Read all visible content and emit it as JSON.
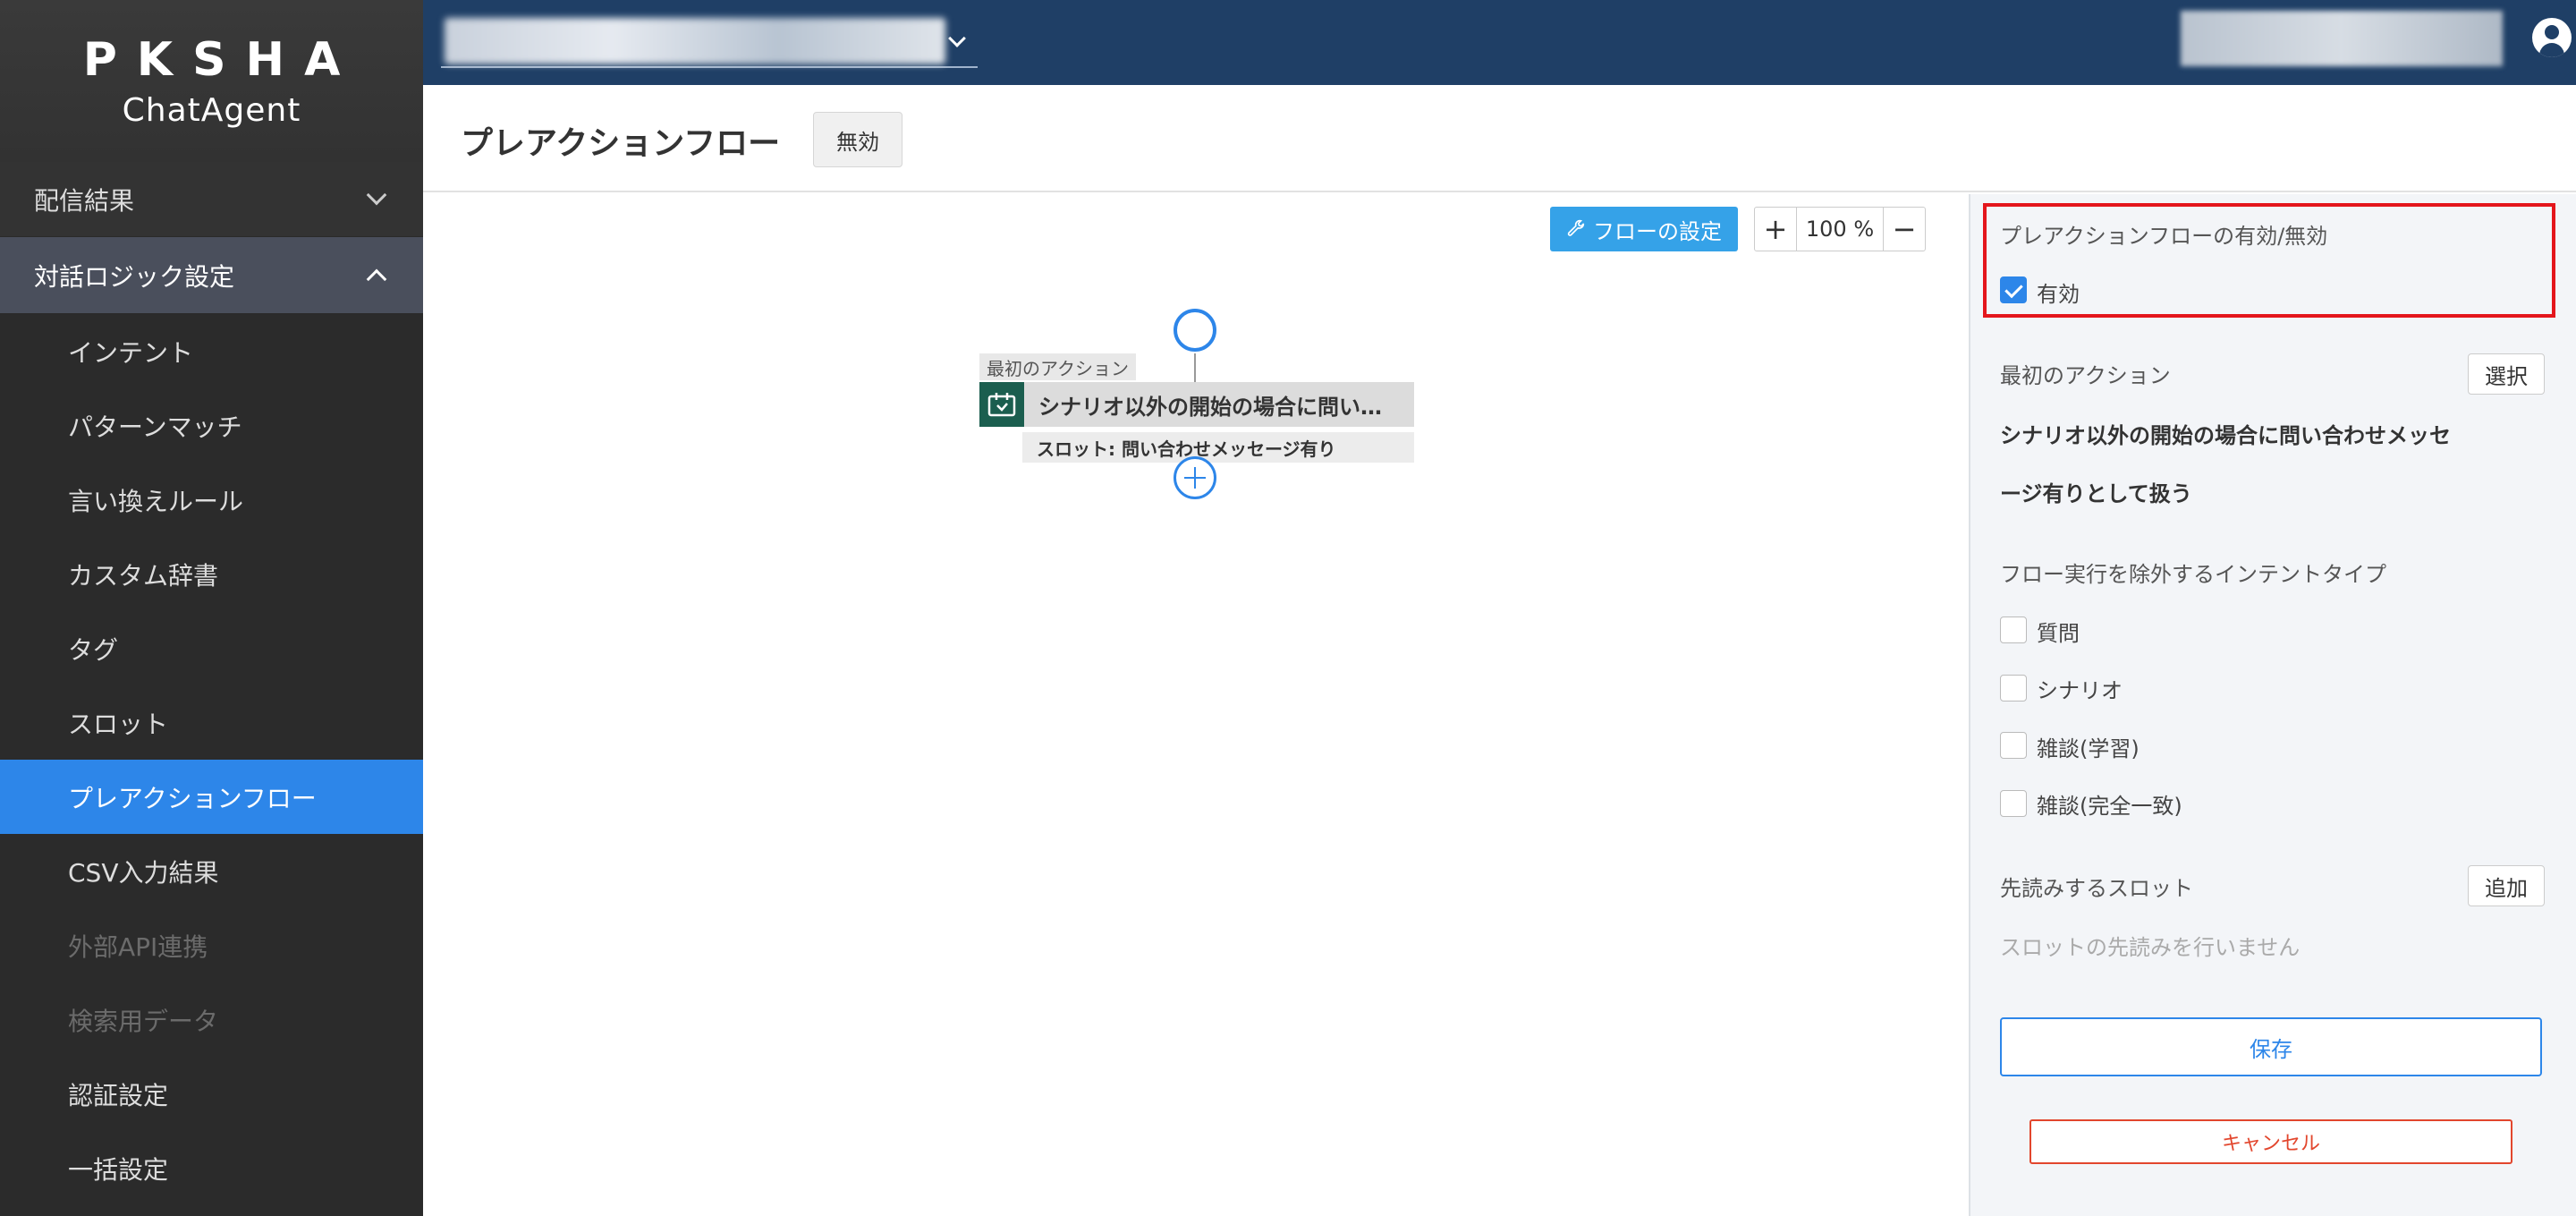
{
  "brand": {
    "name": "PKSHA",
    "product": "ChatAgent"
  },
  "sidebar": {
    "groups": [
      {
        "label": "配信結果"
      },
      {
        "label": "対話ロジック設定"
      }
    ],
    "items": [
      {
        "label": "インテント"
      },
      {
        "label": "パターンマッチ"
      },
      {
        "label": "言い換えルール"
      },
      {
        "label": "カスタム辞書"
      },
      {
        "label": "タグ"
      },
      {
        "label": "スロット"
      },
      {
        "label": "プレアクションフロー"
      },
      {
        "label": "CSV入力結果"
      },
      {
        "label": "外部API連携"
      },
      {
        "label": "検索用データ"
      },
      {
        "label": "認証設定"
      },
      {
        "label": "一括設定"
      }
    ],
    "active_item": "プレアクションフロー"
  },
  "header": {
    "title": "プレアクションフロー",
    "status_label": "無効"
  },
  "canvas": {
    "flow_settings_label": "フローの設定",
    "zoom_in": "+",
    "zoom_value": "100 %",
    "zoom_out": "−",
    "first_action_label": "最初のアクション",
    "action_title": "シナリオ以外の開始の場合に問い…",
    "slot_label": "スロット: 問い合わせメッセージ有り"
  },
  "panel": {
    "toggle_title": "プレアクションフローの有効/無効",
    "enabled_label": "有効",
    "enabled_checked": true,
    "first_action_heading": "最初のアクション",
    "select_button": "選択",
    "first_action_line1": "シナリオ以外の開始の場合に問い合わせメッセ",
    "first_action_line2": "ージ有りとして扱う",
    "exclude_heading": "フロー実行を除外するインテントタイプ",
    "exclude_options": [
      {
        "label": "質問",
        "checked": false
      },
      {
        "label": "シナリオ",
        "checked": false
      },
      {
        "label": "雑談(学習)",
        "checked": false
      },
      {
        "label": "雑談(完全一致)",
        "checked": false
      }
    ],
    "prefetch_heading": "先読みするスロット",
    "add_button": "追加",
    "prefetch_empty": "スロットの先読みを行いません",
    "save_button": "保存",
    "cancel_button": "キャンセル"
  },
  "colors": {
    "sidebar_bg": "#2b2b2b",
    "topbar_bg": "#1f3f66",
    "accent": "#2d86e9",
    "flow_settings_btn": "#35a2e8",
    "highlight_border": "#e4161c",
    "cancel": "#e2462d"
  },
  "icons": [
    "chevron-down-icon",
    "chevron-up-icon",
    "user-account-icon",
    "wrench-icon",
    "action-node-icon",
    "add-node-icon"
  ]
}
